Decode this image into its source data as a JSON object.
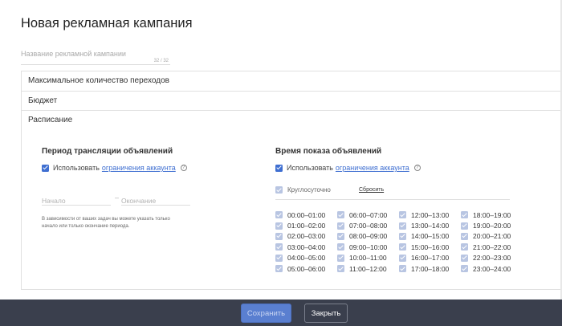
{
  "page": {
    "title": "Новая рекламная кампания"
  },
  "campaign_name": {
    "placeholder": "Название рекламной кампании",
    "value": "",
    "counter": "32 / 32"
  },
  "accordion": {
    "max_clicks": "Максимальное количество переходов",
    "budget": "Бюджет",
    "schedule": "Расписание"
  },
  "period": {
    "title": "Период трансляции объявлений",
    "use_label": "Использовать",
    "limits_link": "ограничения аккаунта",
    "start_placeholder": "Начало",
    "separator": "–",
    "end_placeholder": "Окончание",
    "hint": "В зависимости от ваших задач вы можете указать только начало или только окончание периода."
  },
  "show_time": {
    "title": "Время показа объявлений",
    "use_label": "Использовать",
    "limits_link": "ограничения аккаунта",
    "round_clock_label": "Круглосуточно",
    "reset_label": "Сбросить",
    "slots": [
      "00:00–01:00",
      "06:00–07:00",
      "12:00–13:00",
      "18:00–19:00",
      "01:00–02:00",
      "07:00–08:00",
      "13:00–14:00",
      "19:00–20:00",
      "02:00–03:00",
      "08:00–09:00",
      "14:00–15:00",
      "20:00–21:00",
      "03:00–04:00",
      "09:00–10:00",
      "15:00–16:00",
      "21:00–22:00",
      "04:00–05:00",
      "10:00–11:00",
      "16:00–17:00",
      "22:00–23:00",
      "05:00–06:00",
      "11:00–12:00",
      "17:00–18:00",
      "23:00–24:00"
    ]
  },
  "footer": {
    "save_label": "Сохранить",
    "close_label": "Закрыть"
  },
  "colors": {
    "accent": "#3f6fd1",
    "footer_bg": "#3a3f4d",
    "save_button": "#5a7fd0"
  },
  "icons": {
    "checkbox": "check-icon",
    "info": "info-icon"
  }
}
